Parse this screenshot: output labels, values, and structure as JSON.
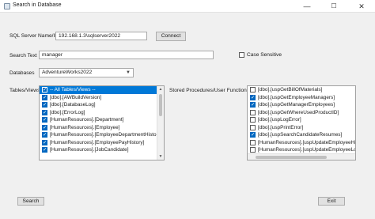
{
  "window": {
    "title": "Search in Database",
    "controls": {
      "minimize": "—",
      "maximize": "☐",
      "close": "✕"
    }
  },
  "server": {
    "label": "SQL Server Name/IP",
    "value": "192.168.1.3\\sqlserver2022",
    "connect_label": "Connect"
  },
  "search": {
    "label": "Search Text",
    "value": "manager",
    "case_sensitive_label": "Case Sensitive",
    "case_sensitive_checked": false
  },
  "database": {
    "label": "Databases",
    "selected": "AdventureWorks2022"
  },
  "tables": {
    "label": "Tables/Views",
    "items": [
      {
        "label": "-- All Tables/Views --",
        "checked": true,
        "selected": true
      },
      {
        "label": "[dbo].[AWBuildVersion]",
        "checked": true
      },
      {
        "label": "[dbo].[DatabaseLog]",
        "checked": true
      },
      {
        "label": "[dbo].[ErrorLog]",
        "checked": true
      },
      {
        "label": "[HumanResources].[Department]",
        "checked": true
      },
      {
        "label": "[HumanResources].[Employee]",
        "checked": true
      },
      {
        "label": "[HumanResources].[EmployeeDepartmentHistory]",
        "checked": true
      },
      {
        "label": "[HumanResources].[EmployeePayHistory]",
        "checked": true
      },
      {
        "label": "[HumanResources].[JobCandidate]",
        "checked": true
      }
    ]
  },
  "procedures": {
    "label": "Stored Procedures/User Functions",
    "items": [
      {
        "label": "[dbo].[uspGetBillOfMaterials]",
        "checked": false
      },
      {
        "label": "[dbo].[uspGetEmployeeManagers]",
        "checked": true
      },
      {
        "label": "[dbo].[uspGetManagerEmployees]",
        "checked": true
      },
      {
        "label": "[dbo].[uspGetWhereUsedProductID]",
        "checked": false
      },
      {
        "label": "[dbo].[uspLogError]",
        "checked": false
      },
      {
        "label": "[dbo].[uspPrintError]",
        "checked": false
      },
      {
        "label": "[dbo].[uspSearchCandidateResumes]",
        "checked": true
      },
      {
        "label": "[HumanResources].[uspUpdateEmployeeHire",
        "checked": false
      },
      {
        "label": "[HumanResources].[uspUpdateEmployeeLogi",
        "checked": false
      }
    ]
  },
  "footer": {
    "search_label": "Search",
    "exit_label": "Exit"
  },
  "colors": {
    "accent": "#0078d7",
    "checkbox": "#0067c0",
    "background": "#f0f0f0"
  }
}
